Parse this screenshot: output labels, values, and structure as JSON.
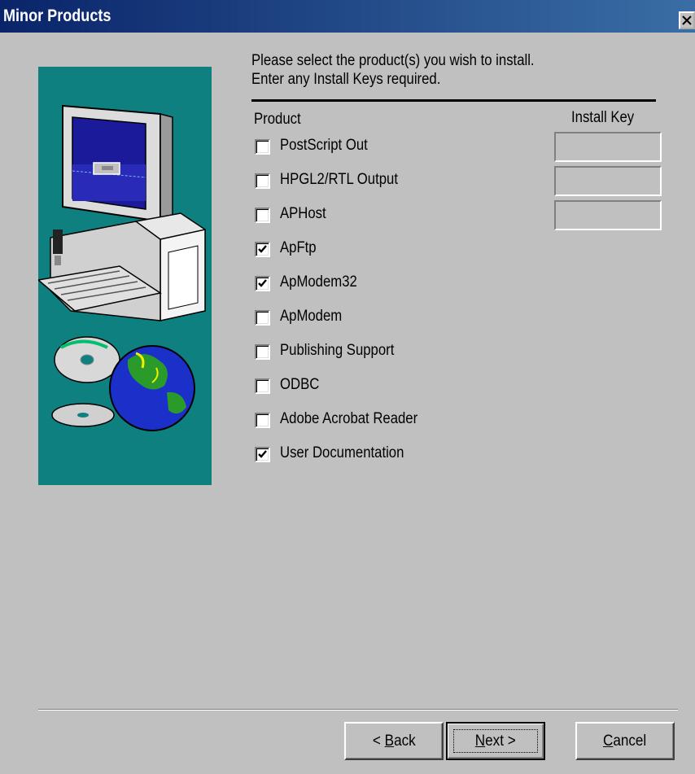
{
  "window": {
    "title": "Minor Products"
  },
  "instructions": {
    "line1": "Please select the product(s) you wish to install.",
    "line2": "Enter any Install Keys required."
  },
  "columns": {
    "product": "Product",
    "install_key": "Install Key"
  },
  "products": [
    {
      "label": "PostScript Out",
      "checked": false,
      "has_key": true,
      "key_value": ""
    },
    {
      "label": "HPGL2/RTL Output",
      "checked": false,
      "has_key": true,
      "key_value": ""
    },
    {
      "label": "APHost",
      "checked": false,
      "has_key": true,
      "key_value": ""
    },
    {
      "label": "ApFtp",
      "checked": true,
      "has_key": false
    },
    {
      "label": "ApModem32",
      "checked": true,
      "has_key": false
    },
    {
      "label": "ApModem",
      "checked": false,
      "has_key": false
    },
    {
      "label": "Publishing Support",
      "checked": false,
      "has_key": false
    },
    {
      "label": "ODBC",
      "checked": false,
      "has_key": false
    },
    {
      "label": "Adobe Acrobat Reader",
      "checked": false,
      "has_key": false
    },
    {
      "label": "User Documentation",
      "checked": true,
      "has_key": false
    }
  ],
  "buttons": {
    "back": {
      "prefix": "< ",
      "mnemonic": "B",
      "rest": "ack"
    },
    "next": {
      "mnemonic": "N",
      "rest": "ext >"
    },
    "cancel": {
      "mnemonic": "C",
      "rest": "ancel"
    }
  },
  "colors": {
    "titlebar": "#0a246a",
    "dialog": "#c0c0c0",
    "art_bg": "#0f8080"
  },
  "icons": {
    "close": "close-icon",
    "art": "computer-globe-illustration"
  }
}
